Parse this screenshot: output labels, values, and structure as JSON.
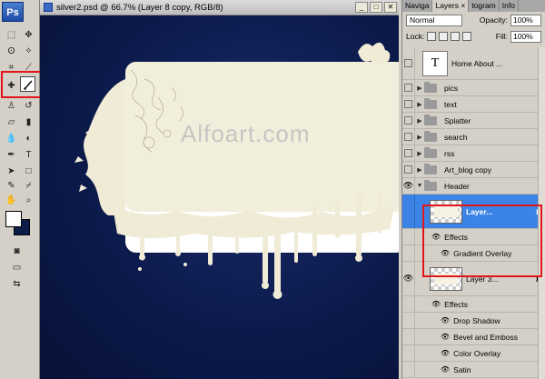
{
  "document": {
    "title": "silver2.psd @ 66.7% (Layer 8 copy, RGB/8)",
    "watermark": "Alfoart.com",
    "win_buttons": [
      "_",
      "□",
      "✕"
    ]
  },
  "toolbox": {
    "logo": "Ps",
    "foreground_color": "#ffffff",
    "background_color": "#0e1c4a"
  },
  "panel": {
    "tabs": [
      "Naviga",
      "Layers ×",
      "togram",
      "Info"
    ],
    "blend_mode": "Normal",
    "opacity_label": "Opacity:",
    "opacity_value": "100%",
    "lock_label": "Lock:",
    "fill_label": "Fill:",
    "fill_value": "100%",
    "layers": [
      {
        "name": "Home  About  ..."
      },
      {
        "name": "pics"
      },
      {
        "name": "text"
      },
      {
        "name": "Splatter"
      },
      {
        "name": "search"
      },
      {
        "name": "rss"
      },
      {
        "name": "Art_blog copy"
      },
      {
        "name": "Header"
      },
      {
        "name": "Layer..."
      },
      {
        "name": "Effects"
      },
      {
        "name": "Gradient Overlay"
      },
      {
        "name": "Layer 3..."
      },
      {
        "name": "Effects"
      },
      {
        "name": "Drop Shadow"
      },
      {
        "name": "Bevel and Emboss"
      },
      {
        "name": "Color Overlay"
      },
      {
        "name": "Satin"
      }
    ],
    "fx_label": "fx",
    "text_thumb": "T"
  },
  "colors": {
    "canvas_bg": "#0c1a4b",
    "selection": "#3b84e6",
    "highlight": "#e3151a",
    "cream": "#f1eedc"
  }
}
